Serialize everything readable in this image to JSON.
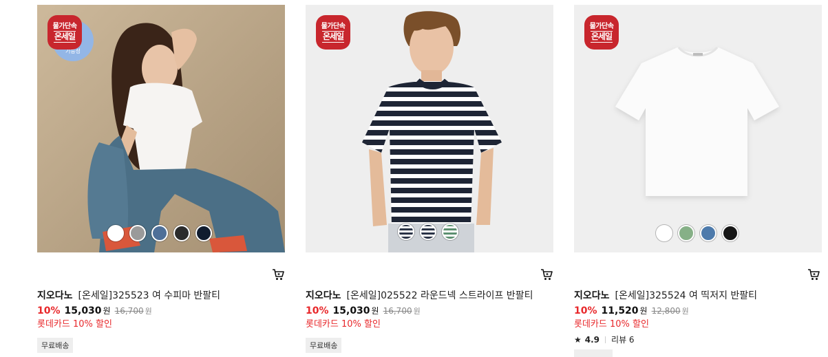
{
  "products": [
    {
      "badge": {
        "line1": "물가단속",
        "line2": "온세일"
      },
      "brand": "지오다노",
      "name": "[온세일]325523 여 수피마 반팔티",
      "discount_rate": "10%",
      "price": "15,030",
      "price_unit": "원",
      "original_price": "16,700",
      "original_unit": "원",
      "card_discount": "롯데카드 10% 할인",
      "tag": "무료배송",
      "feature_label": "기능성",
      "swatches": [
        "#ffffff",
        "#9a9a9a",
        "#4e6f98",
        "#2b2b2b",
        "#111c2e"
      ]
    },
    {
      "badge": {
        "line1": "물가단속",
        "line2": "온세일"
      },
      "brand": "지오다노",
      "name": "[온세일]025522 라운드넥 스트라이프 반팔티",
      "discount_rate": "10%",
      "price": "15,030",
      "price_unit": "원",
      "original_price": "16,700",
      "original_unit": "원",
      "card_discount": "롯데카드 10% 할인",
      "tag": "무료배송",
      "swatches": [
        "stripe-navy",
        "stripe-navy",
        "stripe-green"
      ]
    },
    {
      "badge": {
        "line1": "물가단속",
        "line2": "온세일"
      },
      "brand": "지오다노",
      "name": "[온세일]325524 여 띡저지 반팔티",
      "discount_rate": "10%",
      "price": "11,520",
      "price_unit": "원",
      "original_price": "12,800",
      "original_unit": "원",
      "card_discount": "롯데카드 10% 할인",
      "rating": "4.9",
      "review_label": "리뷰 6",
      "swatches": [
        "#ffffff",
        "#86b087",
        "#4d7aab",
        "#161616"
      ]
    }
  ],
  "icons": {
    "cart": "cart-icon",
    "star": "star-icon"
  },
  "colors": {
    "discount": "#e8282b",
    "badge": "#c8262d"
  }
}
